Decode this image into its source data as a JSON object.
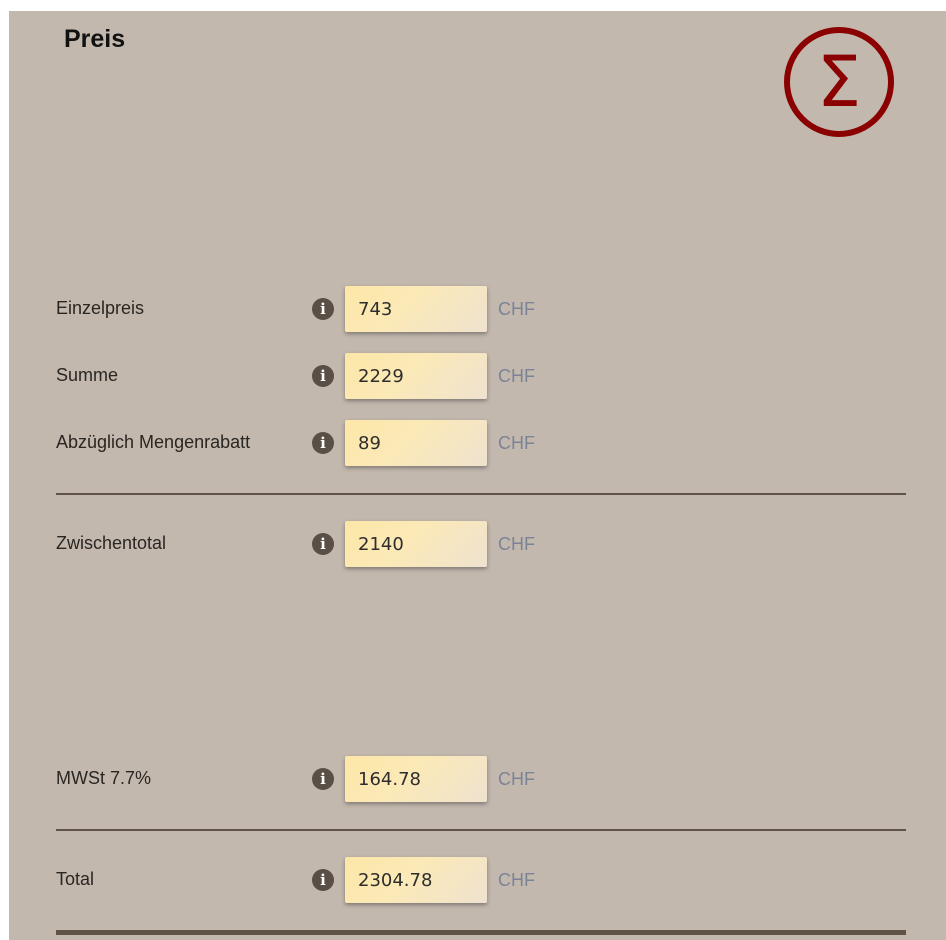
{
  "header": {
    "title": "Preis",
    "logo_icon": "sigma-icon",
    "logo_glyph": "Σ",
    "logo_color": "#8b0000"
  },
  "colors": {
    "panel_background": "#c2b8ae",
    "field_background": "#fde7a6",
    "unit_text": "#7b8396",
    "divider": "#5e5346"
  },
  "rows": [
    {
      "label": "Einzelpreis",
      "info_icon": "info-icon",
      "value": "743",
      "unit": "CHF"
    },
    {
      "label": "Summe",
      "info_icon": "info-icon",
      "value": "2229",
      "unit": "CHF"
    },
    {
      "label": "Abzüglich Mengenrabatt",
      "info_icon": "info-icon",
      "value": "89",
      "unit": "CHF"
    },
    {
      "label": "Zwischentotal",
      "info_icon": "info-icon",
      "value": "2140",
      "unit": "CHF"
    },
    {
      "label": "MWSt 7.7%",
      "info_icon": "info-icon",
      "value": "164.78",
      "unit": "CHF"
    },
    {
      "label": "Total",
      "info_icon": "info-icon",
      "value": "2304.78",
      "unit": "CHF"
    }
  ]
}
